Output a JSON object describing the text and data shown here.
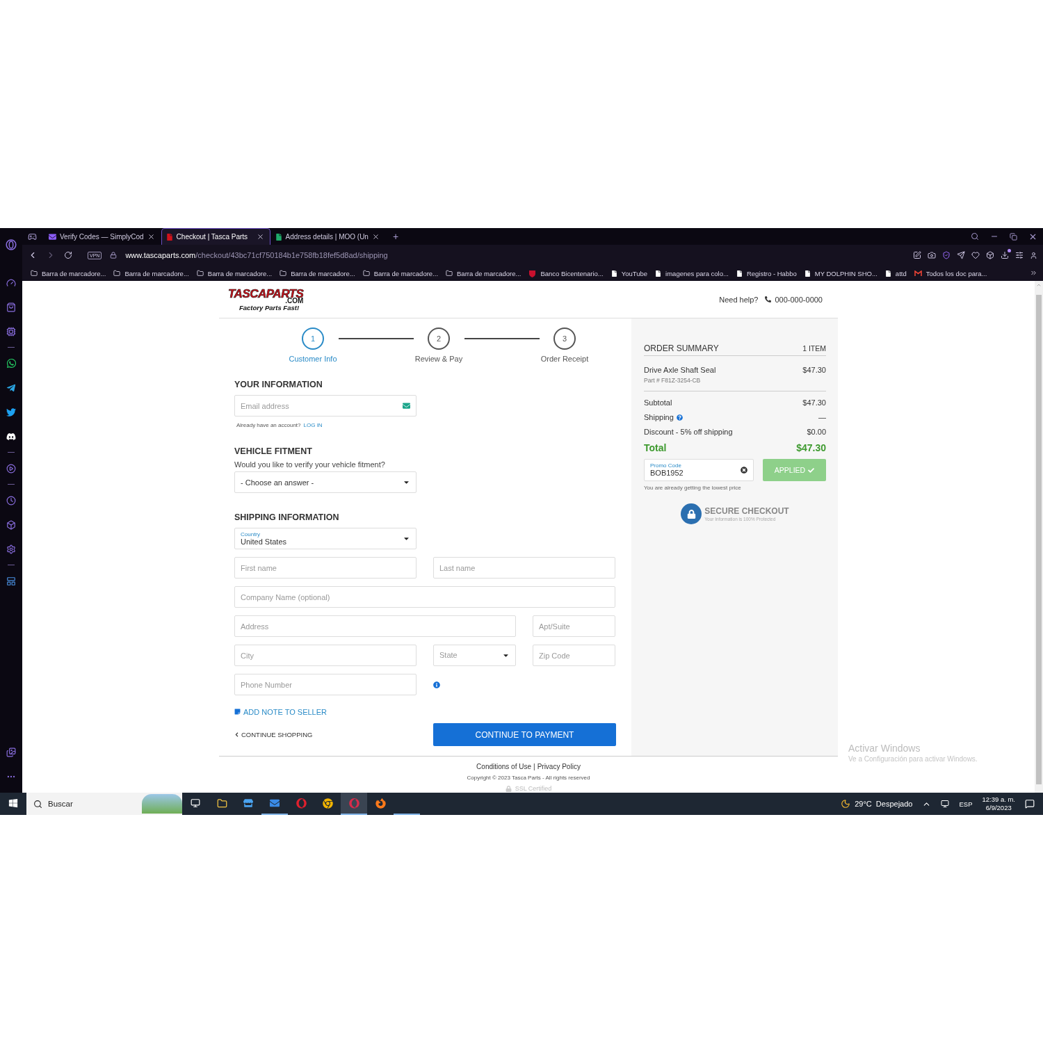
{
  "browser": {
    "tabs": [
      {
        "title": "Verify Codes — SimplyCod",
        "selected": false
      },
      {
        "title": "Checkout | Tasca Parts",
        "selected": true
      },
      {
        "title": "Address details | MOO (Un",
        "selected": false
      }
    ],
    "new_tab": "+",
    "vpn": "VPN",
    "url_host": "www.tascaparts.com",
    "url_path": "/checkout/43bc71cf750184b1e758fb18fef5d8ad/shipping",
    "bookmarks": [
      {
        "label": "Barra de marcadore...",
        "kind": "folder"
      },
      {
        "label": "Barra de marcadore...",
        "kind": "folder"
      },
      {
        "label": "Barra de marcadore...",
        "kind": "folder"
      },
      {
        "label": "Barra de marcadore...",
        "kind": "folder"
      },
      {
        "label": "Barra de marcadore...",
        "kind": "folder"
      },
      {
        "label": "Barra de marcadore...",
        "kind": "folder"
      },
      {
        "label": "Banco Bicentenario...",
        "kind": "bank"
      },
      {
        "label": "YouTube",
        "kind": "page"
      },
      {
        "label": "imagenes para colo...",
        "kind": "page"
      },
      {
        "label": "Registro - Habbo",
        "kind": "page"
      },
      {
        "label": "MY DOLPHIN SHO...",
        "kind": "page"
      },
      {
        "label": "attd",
        "kind": "page"
      },
      {
        "label": "Todos los doc para...",
        "kind": "mail"
      }
    ]
  },
  "header": {
    "logo_main": "TASCAPARTS",
    "logo_domain": ".COM",
    "logo_tagline": "Factory Parts Fast!",
    "help": "Need help?",
    "phone": "000-000-0000"
  },
  "steps": [
    {
      "number": "1",
      "label": "Customer Info",
      "selected": true
    },
    {
      "number": "2",
      "label": "Review & Pay",
      "selected": false
    },
    {
      "number": "3",
      "label": "Order Receipt",
      "selected": false
    }
  ],
  "your_info": {
    "title": "YOUR INFORMATION",
    "email_placeholder": "Email address",
    "account_prompt": "Already have an account?",
    "login": "LOG IN"
  },
  "vehicle": {
    "title": "VEHICLE FITMENT",
    "question": "Would you like to verify your vehicle fitment?",
    "placeholder": "- Choose an answer -"
  },
  "shipping": {
    "title": "SHIPPING INFORMATION",
    "fields": [
      {
        "kind": "select",
        "label": "Country",
        "value": "United States"
      },
      {
        "kind": "input",
        "placeholder": "First name"
      },
      {
        "kind": "input",
        "placeholder": "Last name"
      },
      {
        "kind": "input",
        "placeholder": "Company Name (optional)"
      },
      {
        "kind": "input",
        "placeholder": "Address"
      },
      {
        "kind": "input",
        "placeholder": "Apt/Suite"
      },
      {
        "kind": "input",
        "placeholder": "City"
      },
      {
        "kind": "select",
        "placeholder": "State"
      },
      {
        "kind": "input",
        "placeholder": "Zip Code"
      },
      {
        "kind": "input",
        "placeholder": "Phone Number",
        "info": true
      }
    ]
  },
  "add_note": "ADD NOTE TO SELLER",
  "continue_shopping": "CONTINUE SHOPPING",
  "continue_payment": "CONTINUE TO PAYMENT",
  "summary": {
    "title": "ORDER SUMMARY",
    "count": "1 ITEM",
    "item": {
      "name": "Drive Axle Shaft Seal",
      "part": "Part # F81Z-3254-CB",
      "price": "$47.30"
    },
    "lines": [
      {
        "label": "Subtotal",
        "value": "$47.30",
        "help": false
      },
      {
        "label": "Shipping",
        "value": "—",
        "help": true
      },
      {
        "label": "Discount - 5% off shipping",
        "value": "$0.00",
        "help": false
      }
    ],
    "total_label": "Total",
    "total_value": "$47.30",
    "promo_label": "Promo Code",
    "promo_value": "BOB1952",
    "applied": "APPLIED",
    "promo_note": "You are already getting the lowest price",
    "secure_title": "SECURE CHECKOUT",
    "secure_subtitle": "Your Information is 100% Protected"
  },
  "footer": {
    "conditions": "Conditions of Use",
    "separator": "|",
    "privacy": "Privacy Policy",
    "copyright": "Copyright © 2023 Tasca Parts - All rights reserved",
    "ssl": "SSL Certified"
  },
  "activation": {
    "title": "Activar Windows",
    "subtitle": "Ve a Configuración para activar Windows."
  },
  "taskbar": {
    "search": "Buscar",
    "weather": "29°C  Despejado",
    "language": "ESP",
    "time": "12:39 a. m.",
    "date": "6/9/2023"
  }
}
